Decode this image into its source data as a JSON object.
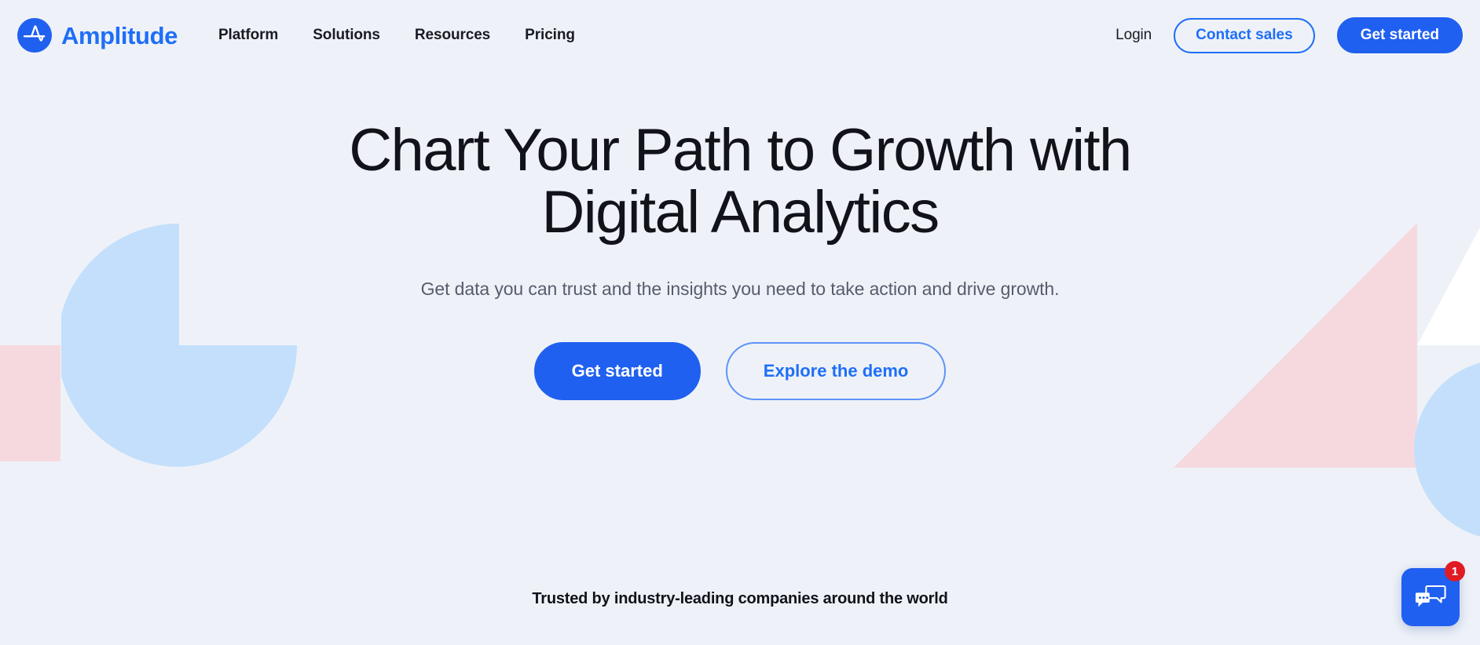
{
  "brand": {
    "name": "Amplitude",
    "logo_icon": "amplitude-logo-icon",
    "color": "#1f6ef7"
  },
  "header": {
    "nav": [
      {
        "label": "Platform"
      },
      {
        "label": "Solutions"
      },
      {
        "label": "Resources"
      },
      {
        "label": "Pricing"
      }
    ],
    "login_label": "Login",
    "contact_sales_label": "Contact sales",
    "get_started_label": "Get started"
  },
  "hero": {
    "title_line_1": "Chart Your Path to Growth with",
    "title_line_2": "Digital Analytics",
    "subtitle": "Get data you can trust and the insights you need to take action and drive growth.",
    "primary_cta_label": "Get started",
    "secondary_cta_label": "Explore the demo"
  },
  "trusted": {
    "text": "Trusted by industry-leading companies around the world"
  },
  "chat": {
    "icon": "chat-bubbles-icon",
    "badge_count": "1",
    "badge_color": "#e01b24",
    "button_color": "#2060f0"
  },
  "decor": {
    "blue": "#c3dffb",
    "pink": "#f6d9df",
    "white": "#ffffff",
    "background": "#eef2f8"
  }
}
